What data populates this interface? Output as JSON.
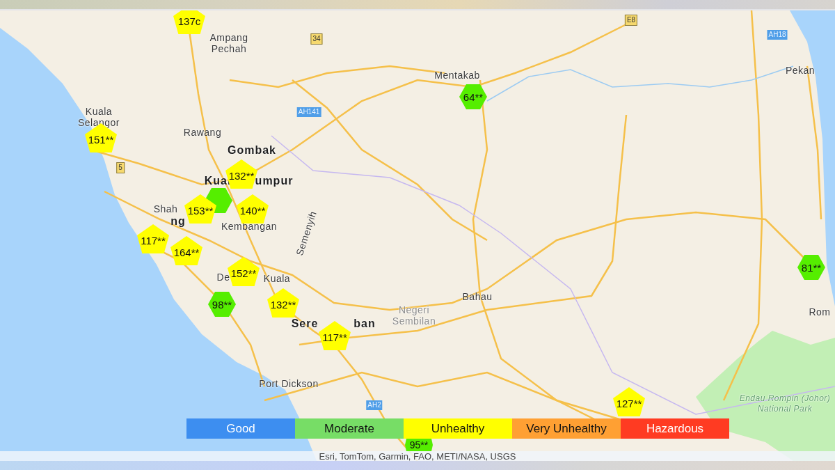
{
  "map": {
    "places": [
      {
        "name": "Ampang Pechah",
        "kind": "town"
      },
      {
        "name": "Kuala Selangor",
        "kind": "town"
      },
      {
        "name": "Rawang",
        "kind": "town"
      },
      {
        "name": "Gombak",
        "kind": "city"
      },
      {
        "name": "Kual",
        "kind": "city"
      },
      {
        "name": "umpur",
        "kind": "city"
      },
      {
        "name": "Shah",
        "kind": "town"
      },
      {
        "name": "ng",
        "kind": "city"
      },
      {
        "name": "Kembangan",
        "kind": "town"
      },
      {
        "name": "De",
        "kind": "town"
      },
      {
        "name": "Kuala",
        "kind": "town"
      },
      {
        "name": "Semenyih",
        "kind": "town"
      },
      {
        "name": "Sere",
        "kind": "city"
      },
      {
        "name": "ban",
        "kind": "city"
      },
      {
        "name": "Negeri Sembilan",
        "kind": "region"
      },
      {
        "name": "Bahau",
        "kind": "town"
      },
      {
        "name": "Port Dickson",
        "kind": "town"
      },
      {
        "name": "Mentakab",
        "kind": "town"
      },
      {
        "name": "Pekan",
        "kind": "town"
      },
      {
        "name": "Rom",
        "kind": "town"
      },
      {
        "name": "Endau Rompin (Johor) National Park",
        "kind": "park"
      }
    ],
    "shields": [
      {
        "label": "34",
        "kind": "highway"
      },
      {
        "label": "E8",
        "kind": "highway"
      },
      {
        "label": "AH18",
        "kind": "asian"
      },
      {
        "label": "AH141",
        "kind": "asian"
      },
      {
        "label": "5",
        "kind": "highway"
      },
      {
        "label": "AH2",
        "kind": "asian"
      }
    ],
    "markers": [
      {
        "label": "137c",
        "kind": "pentagon",
        "color": "#ffff00"
      },
      {
        "label": "151**",
        "kind": "pentagon",
        "color": "#ffff00"
      },
      {
        "kind": "hexagon",
        "color": "#55ee00"
      },
      {
        "label": "132**",
        "kind": "pentagon",
        "color": "#ffff00"
      },
      {
        "label": "153**",
        "kind": "pentagon",
        "color": "#ffff00"
      },
      {
        "label": "140**",
        "kind": "pentagon",
        "color": "#ffff00"
      },
      {
        "label": "117**",
        "kind": "pentagon",
        "color": "#ffff00"
      },
      {
        "label": "164**",
        "kind": "pentagon",
        "color": "#ffff00"
      },
      {
        "label": "152**",
        "kind": "pentagon",
        "color": "#ffff00"
      },
      {
        "label": "98**",
        "kind": "hexagon",
        "color": "#55ee00"
      },
      {
        "label": "132**",
        "kind": "pentagon",
        "color": "#ffff00"
      },
      {
        "label": "117**",
        "kind": "pentagon",
        "color": "#ffff00"
      },
      {
        "label": "64**",
        "kind": "hexagon",
        "color": "#55ee00"
      },
      {
        "label": "81**",
        "kind": "hexagon",
        "color": "#55ee00"
      },
      {
        "label": "127**",
        "kind": "pentagon",
        "color": "#ffff00"
      },
      {
        "label": "95**",
        "kind": "hexagon",
        "color": "#55ee00"
      }
    ],
    "legend": [
      {
        "label": "Good",
        "color": "#3d8ef0"
      },
      {
        "label": "Moderate",
        "color": "#77dd66"
      },
      {
        "label": "Unhealthy",
        "color": "#ffff00"
      },
      {
        "label": "Very Unhealthy",
        "color": "#ffa033"
      },
      {
        "label": "Hazardous",
        "color": "#ff3b22"
      }
    ],
    "attribution": "Esri, TomTom, Garmin, FAO, METI/NASA, USGS"
  }
}
